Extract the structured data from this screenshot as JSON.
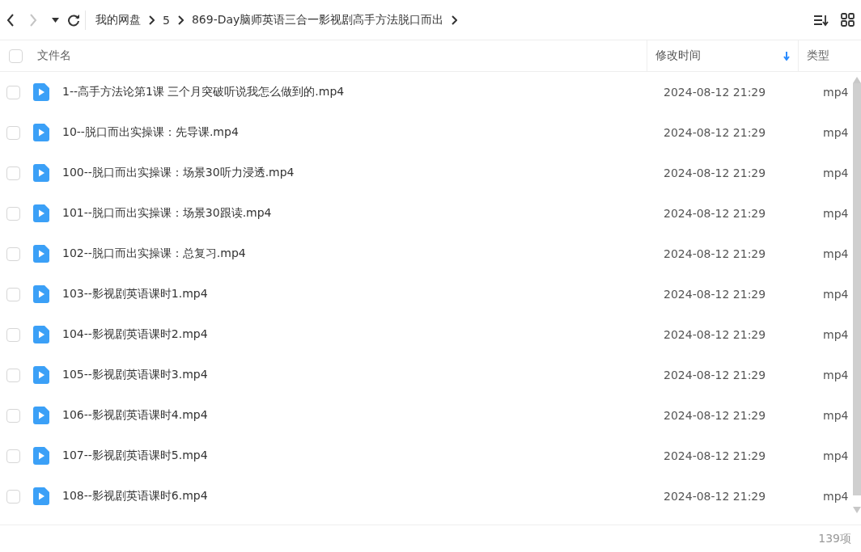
{
  "nav": {
    "back_disabled": false,
    "forward_disabled": true
  },
  "breadcrumb": [
    "我的网盘",
    "5",
    "869-Day脑师英语三合一影视剧高手方法脱口而出"
  ],
  "table": {
    "select_all_checked": false,
    "columns": [
      {
        "label": "文件名",
        "sorted": false
      },
      {
        "label": "修改时间",
        "sorted": true
      },
      {
        "label": "类型",
        "sorted": false
      }
    ],
    "rows": [
      {
        "name": "1--高手方法论第1课 三个月突破听说我怎么做到的.mp4",
        "modified": "2024-08-12 21:29",
        "type": "mp4",
        "checked": false
      },
      {
        "name": "10--脱口而出实操课：先导课.mp4",
        "modified": "2024-08-12 21:29",
        "type": "mp4",
        "checked": false
      },
      {
        "name": "100--脱口而出实操课：场景30听力浸透.mp4",
        "modified": "2024-08-12 21:29",
        "type": "mp4",
        "checked": false
      },
      {
        "name": "101--脱口而出实操课：场景30跟读.mp4",
        "modified": "2024-08-12 21:29",
        "type": "mp4",
        "checked": false
      },
      {
        "name": "102--脱口而出实操课：总复习.mp4",
        "modified": "2024-08-12 21:29",
        "type": "mp4",
        "checked": false
      },
      {
        "name": "103--影视剧英语课时1.mp4",
        "modified": "2024-08-12 21:29",
        "type": "mp4",
        "checked": false
      },
      {
        "name": "104--影视剧英语课时2.mp4",
        "modified": "2024-08-12 21:29",
        "type": "mp4",
        "checked": false
      },
      {
        "name": "105--影视剧英语课时3.mp4",
        "modified": "2024-08-12 21:29",
        "type": "mp4",
        "checked": false
      },
      {
        "name": "106--影视剧英语课时4.mp4",
        "modified": "2024-08-12 21:29",
        "type": "mp4",
        "checked": false
      },
      {
        "name": "107--影视剧英语课时5.mp4",
        "modified": "2024-08-12 21:29",
        "type": "mp4",
        "checked": false
      },
      {
        "name": "108--影视剧英语课时6.mp4",
        "modified": "2024-08-12 21:29",
        "type": "mp4",
        "checked": false
      }
    ]
  },
  "status_bar": {
    "count": "139项"
  }
}
